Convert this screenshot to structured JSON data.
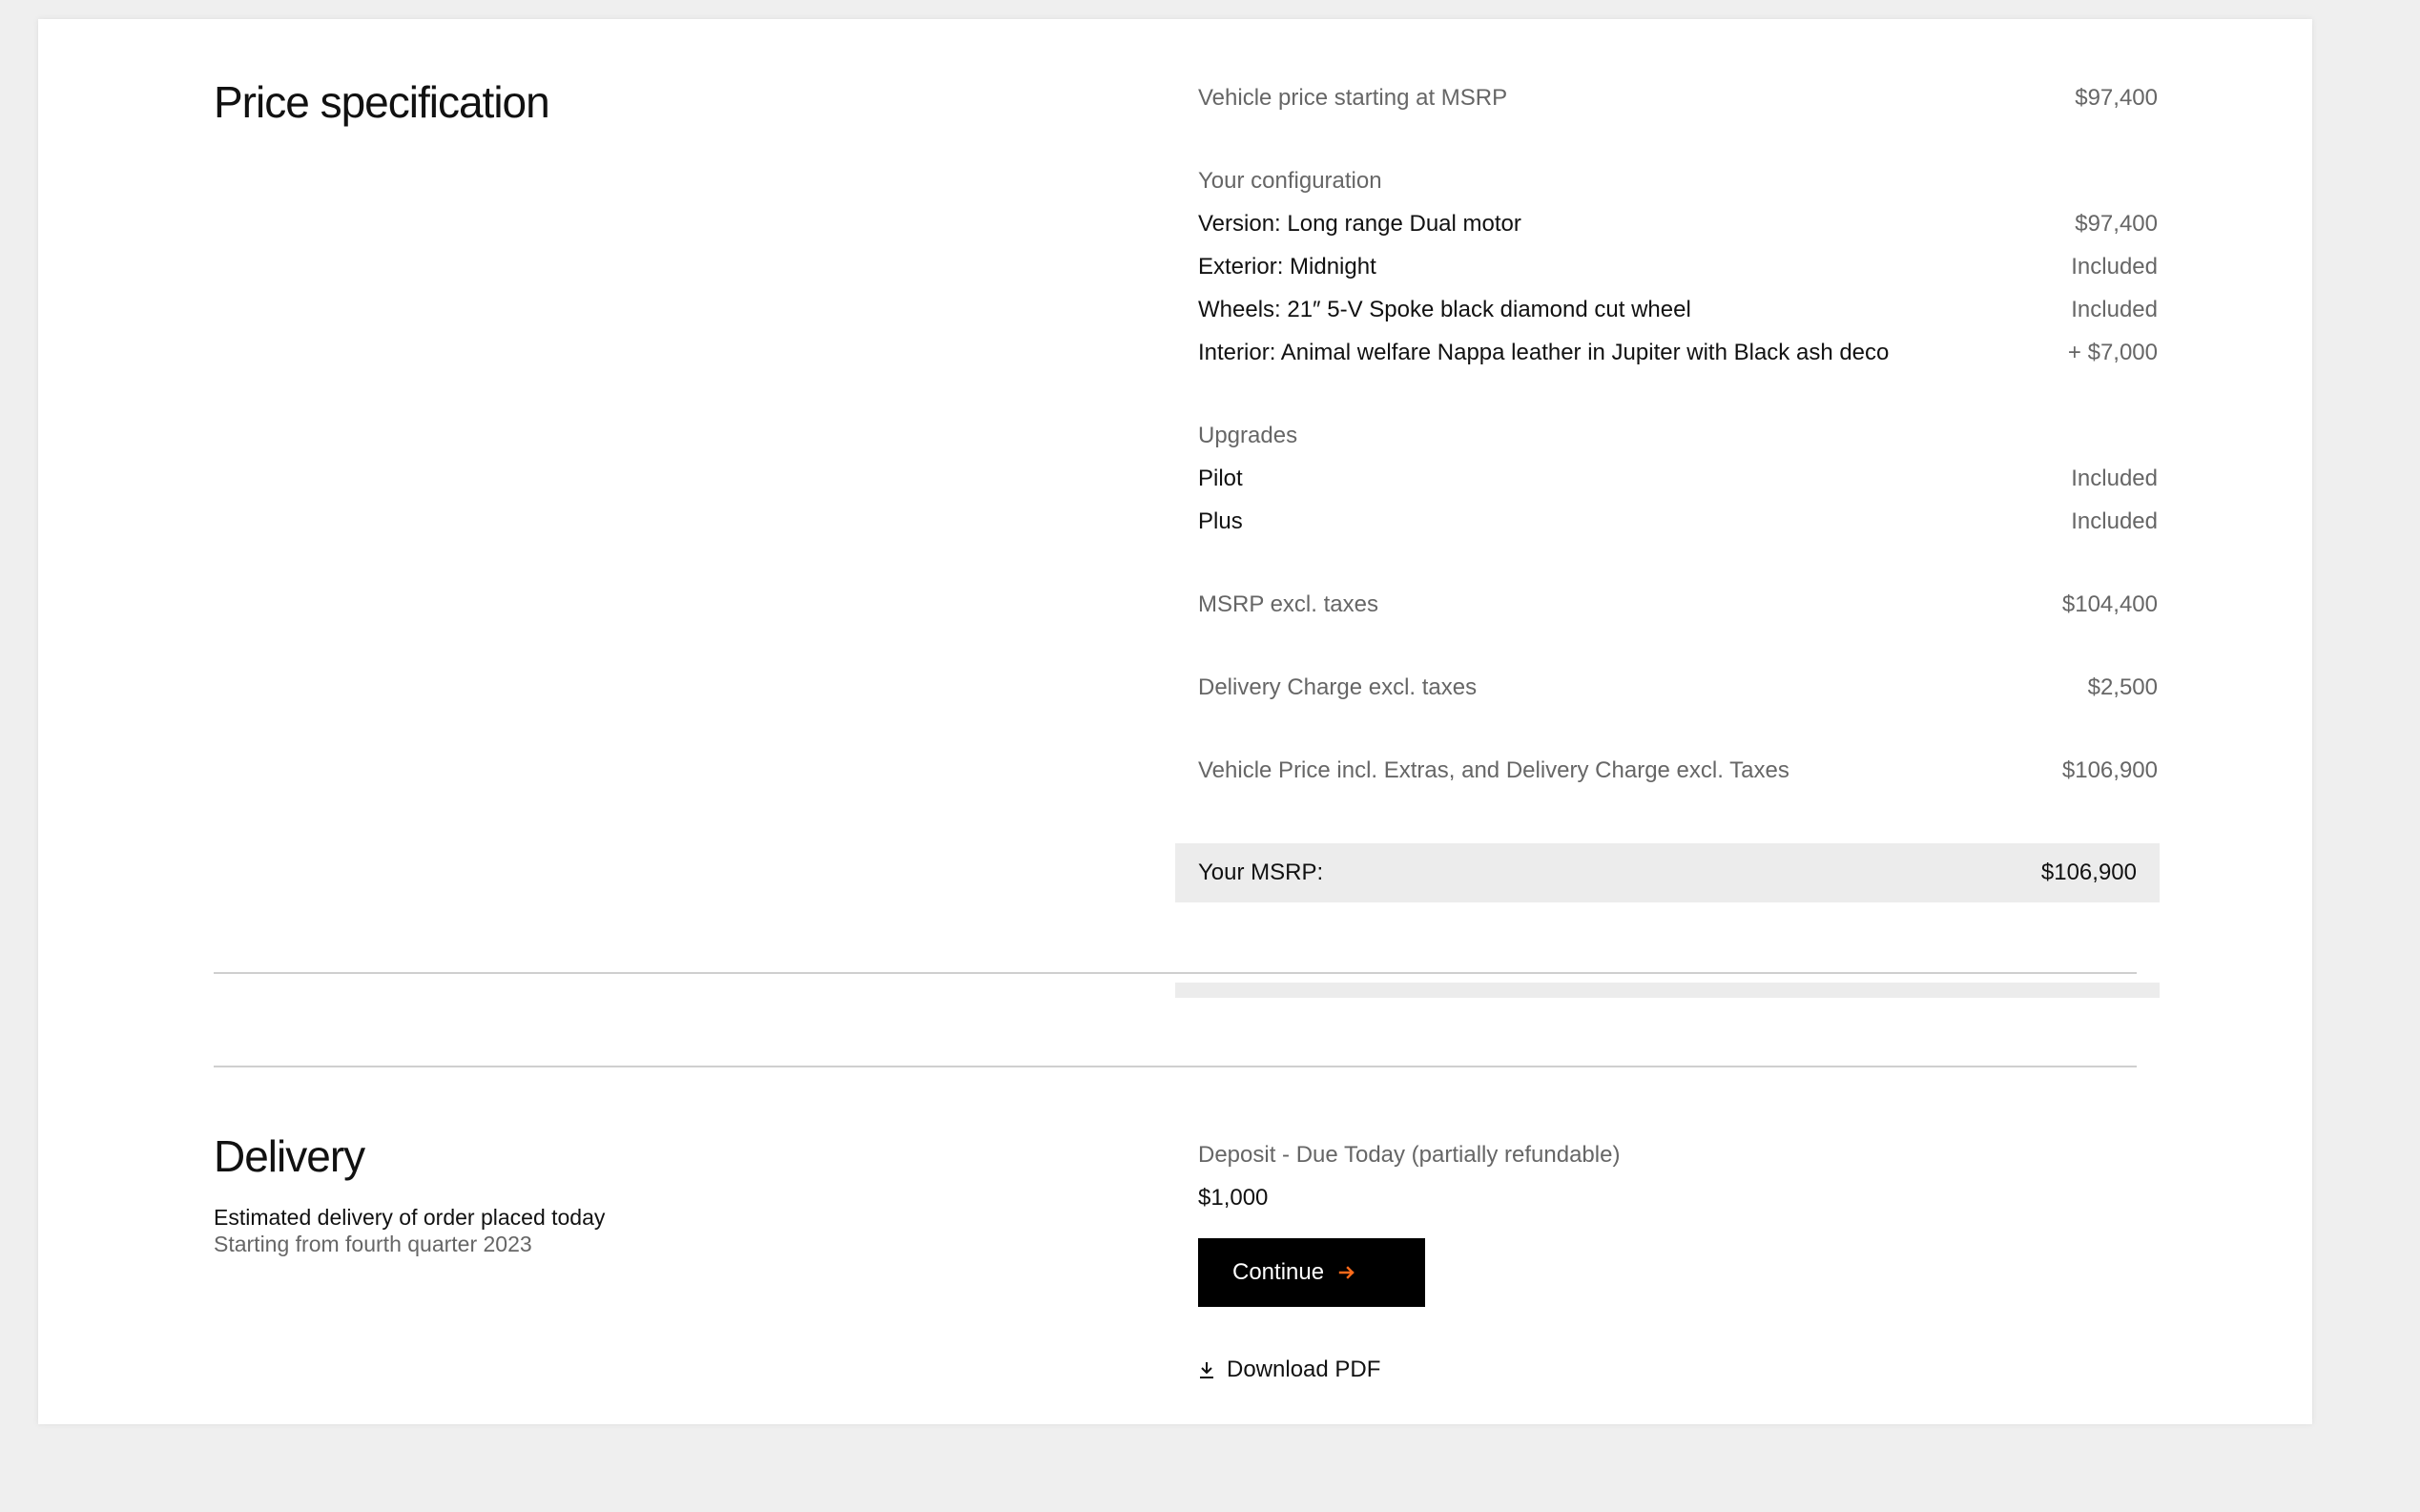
{
  "price_section": {
    "title": "Price specification",
    "starting": {
      "label": "Vehicle price starting at MSRP",
      "value": "$97,400"
    },
    "config_heading": "Your configuration",
    "config": [
      {
        "label": "Version: Long range Dual motor",
        "value": "$97,400"
      },
      {
        "label": "Exterior: Midnight",
        "value": "Included"
      },
      {
        "label": "Wheels: 21″ 5-V Spoke black diamond cut wheel",
        "value": "Included"
      },
      {
        "label": "Interior: Animal welfare Nappa leather in Jupiter with Black ash deco",
        "value": "+ $7,000"
      }
    ],
    "upgrades_heading": "Upgrades",
    "upgrades": [
      {
        "label": "Pilot",
        "value": "Included"
      },
      {
        "label": "Plus",
        "value": "Included"
      }
    ],
    "msrp_excl": {
      "label": "MSRP excl. taxes",
      "value": "$104,400"
    },
    "delivery_charge": {
      "label": "Delivery Charge excl. taxes",
      "value": "$2,500"
    },
    "vehicle_price_incl": {
      "label": "Vehicle Price incl. Extras, and Delivery Charge excl. Taxes",
      "value": "$106,900"
    },
    "total": {
      "label": "Your MSRP:",
      "value": "$106,900"
    }
  },
  "delivery_section": {
    "title": "Delivery",
    "estimate_line1": "Estimated delivery of order placed today",
    "estimate_line2": "Starting from fourth quarter 2023",
    "deposit_label": "Deposit - Due Today (partially refundable)",
    "deposit_amount": "$1,000",
    "continue_label": "Continue",
    "download_label": "Download PDF"
  },
  "icons": {
    "continue_arrow": "arrow-right-icon",
    "download": "download-icon"
  },
  "colors": {
    "accent_arrow": "#ff6a1a",
    "button_bg": "#000000",
    "total_bar_bg": "#ececec"
  }
}
